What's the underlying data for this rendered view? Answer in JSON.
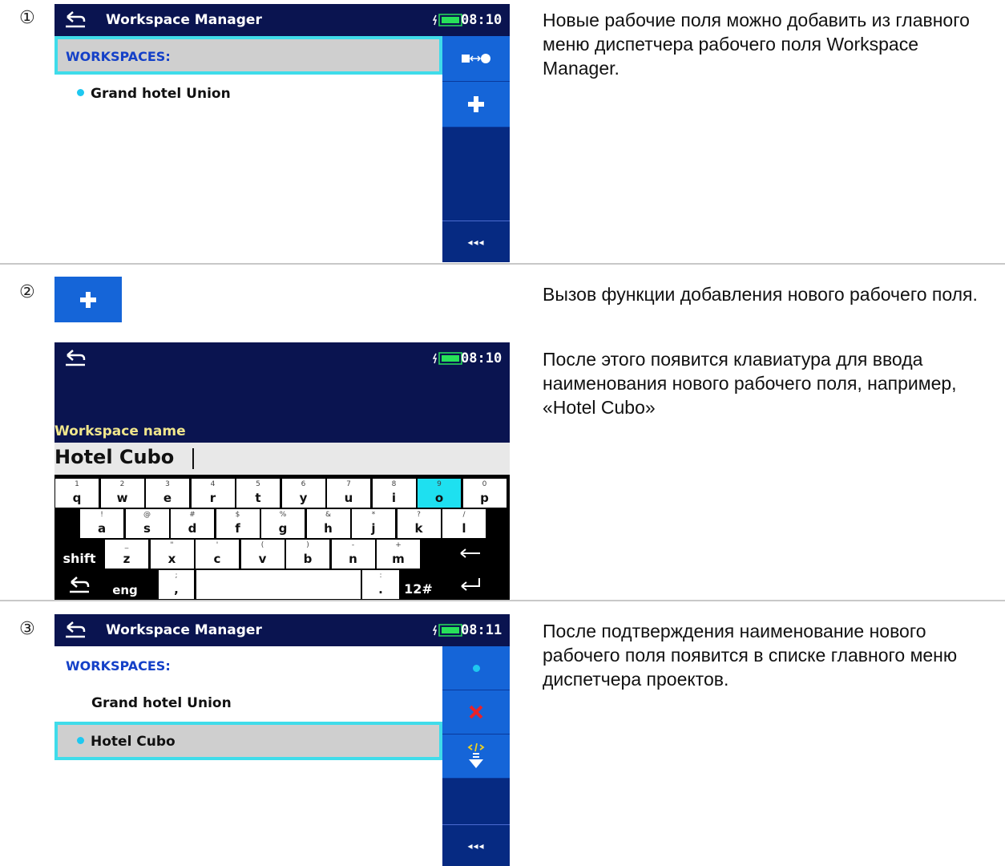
{
  "steps": [
    {
      "num": "①",
      "description": "Новые рабочие поля можно добавить из главного меню диспетчера рабочего поля Workspace Manager."
    },
    {
      "num": "②",
      "description": "Вызов функции добавления нового рабочего поля.",
      "description2": "После этого появится клавиатура для ввода наименования нового рабочего поля, например, «Hotel Cubo»"
    },
    {
      "num": "③",
      "description": "После подтверждения наименование нового рабочего поля появится в списке главного меню диспетчера проектов."
    }
  ],
  "screen1": {
    "title": "Workspace Manager",
    "time": "08:10",
    "header": "WORKSPACES:",
    "items": [
      "Grand hotel Union"
    ],
    "more": "◂◂◂"
  },
  "screen2": {
    "time": "08:10",
    "field_label": "Workspace name",
    "field_value": "Hotel Cubo",
    "keys_row1": [
      {
        "sub": "1",
        "main": "q"
      },
      {
        "sub": "2",
        "main": "w"
      },
      {
        "sub": "3",
        "main": "e"
      },
      {
        "sub": "4",
        "main": "r"
      },
      {
        "sub": "5",
        "main": "t"
      },
      {
        "sub": "6",
        "main": "y"
      },
      {
        "sub": "7",
        "main": "u"
      },
      {
        "sub": "8",
        "main": "i"
      },
      {
        "sub": "9",
        "main": "o"
      },
      {
        "sub": "0",
        "main": "p"
      }
    ],
    "keys_row2": [
      {
        "sub": "!",
        "main": "a"
      },
      {
        "sub": "@",
        "main": "s"
      },
      {
        "sub": "#",
        "main": "d"
      },
      {
        "sub": "$",
        "main": "f"
      },
      {
        "sub": "%",
        "main": "g"
      },
      {
        "sub": "&",
        "main": "h"
      },
      {
        "sub": "*",
        "main": "j"
      },
      {
        "sub": "?",
        "main": "k"
      },
      {
        "sub": "/",
        "main": "l"
      }
    ],
    "keys_row3": [
      {
        "sub": "_",
        "main": "z"
      },
      {
        "sub": "\"",
        "main": "x"
      },
      {
        "sub": "'",
        "main": "c"
      },
      {
        "sub": "(",
        "main": "v"
      },
      {
        "sub": ")",
        "main": "b"
      },
      {
        "sub": "-",
        "main": "n"
      },
      {
        "sub": "+",
        "main": "m"
      }
    ],
    "shift_label": "shift",
    "eng_label": "eng",
    "comma_sub": ";",
    "comma_main": ",",
    "dot_sub": ":",
    "dot_main": ".",
    "num_label": "12#"
  },
  "screen3": {
    "title": "Workspace Manager",
    "time": "08:11",
    "header": "WORKSPACES:",
    "items": [
      "Grand hotel Union",
      "Hotel Cubo"
    ],
    "more": "◂◂◂"
  },
  "colors": {
    "topbar": "#0a1450",
    "sidebar": "#062a82",
    "sidebar_button": "#1565d8",
    "highlight_border": "#3fdcea",
    "header_text": "#1440c8",
    "active_dot": "#1ec8f0",
    "delete_icon": "#e8222a"
  },
  "icons": [
    "back-arrow-icon",
    "battery-icon",
    "switch-icon",
    "plus-icon",
    "more-icon",
    "dot-icon",
    "delete-icon",
    "export-icon",
    "backspace-icon",
    "enter-icon"
  ]
}
